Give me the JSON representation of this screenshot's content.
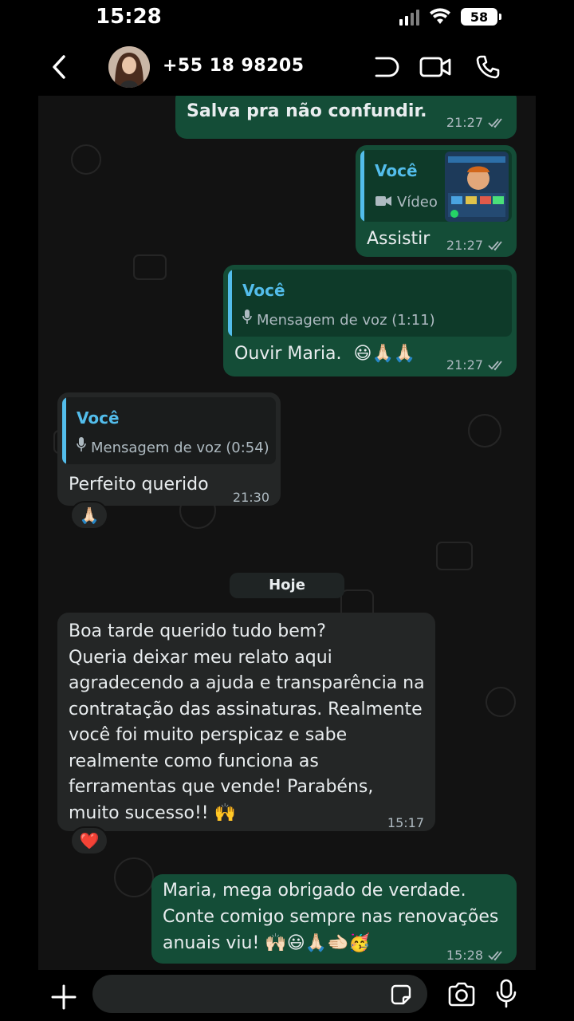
{
  "status_bar": {
    "time": "15:28",
    "battery": "58"
  },
  "header": {
    "contact_name": "+55 18 98205"
  },
  "messages": [
    {
      "text": "Salva pra não confundir.",
      "time": "21:27"
    },
    {
      "quote_author": "Você",
      "quote_sub": "Vídeo",
      "text": "Assistir",
      "time": "21:27"
    },
    {
      "quote_author": "Você",
      "quote_sub": "Mensagem de voz (1:11)",
      "text": "Ouvir Maria.",
      "emoji": "😃🙏🏻🙏🏻",
      "time": "21:27"
    },
    {
      "quote_author": "Você",
      "quote_sub": "Mensagem de voz (0:54)",
      "text": "Perfeito querido",
      "time": "21:30",
      "reaction": "🙏🏻"
    },
    {
      "lines": [
        "Boa tarde querido tudo bem?",
        "Queria deixar meu relato aqui",
        "agradecendo a ajuda e transparência na",
        "contratação das assinaturas. Realmente",
        "você foi muito perspicaz e sabe",
        "realmente como funciona as",
        "ferramentas que vende! Parabéns,",
        "muito sucesso!! 🙌"
      ],
      "time": "15:17",
      "reaction": "❤️"
    },
    {
      "lines": [
        "Maria, mega obrigado de verdade.",
        "Conte comigo sempre nas renovações",
        "anuais viu! 🙌🏻😃🙏🏻🫲🏻🥳"
      ],
      "time": "15:28"
    }
  ],
  "date_separator": "Hoje",
  "composer": {
    "placeholder": ""
  },
  "colors": {
    "outgoing": "#144d37",
    "incoming": "#242626",
    "accent": "#53bdeb",
    "background": "#000000"
  }
}
